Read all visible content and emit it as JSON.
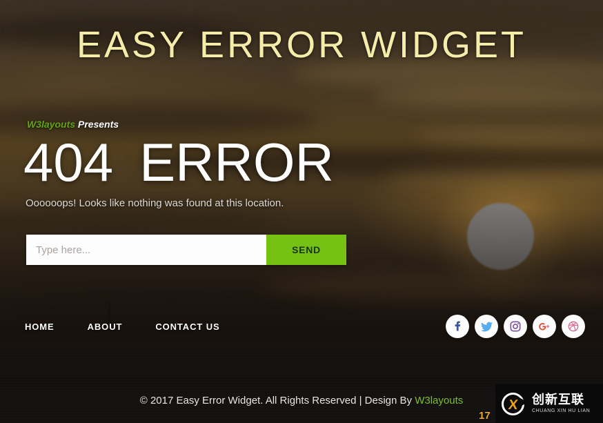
{
  "site": {
    "title": "EASY ERROR WIDGET",
    "title_color": "#f6ecaa"
  },
  "hero": {
    "presents_brand": "W3layouts",
    "presents_text": "Presents",
    "error_code": "404",
    "error_word": "ERROR",
    "subtitle": "Oooooops! Looks like nothing was found at this location."
  },
  "search": {
    "placeholder": "Type here...",
    "value": "",
    "button_label": "SEND",
    "button_color": "#76c214"
  },
  "nav": {
    "items": [
      {
        "label": "HOME",
        "name": "nav-link-home"
      },
      {
        "label": "ABOUT",
        "name": "nav-link-about"
      },
      {
        "label": "CONTACT  US",
        "name": "nav-link-contact-us"
      }
    ]
  },
  "socials": {
    "items": [
      {
        "icon": "facebook-icon",
        "glyph": "f",
        "color": "#3b5998"
      },
      {
        "icon": "twitter-icon",
        "glyph": "bird",
        "color": "#55acee"
      },
      {
        "icon": "instagram-icon",
        "glyph": "camera",
        "color": "#7d4fa0"
      },
      {
        "icon": "google-plus-icon",
        "glyph": "G+",
        "color": "#dd4b39"
      },
      {
        "icon": "dribbble-icon",
        "glyph": "ball",
        "color": "#d playfully"
      }
    ]
  },
  "footer": {
    "text_before": "© 2017 Easy Error Widget. All Rights Reserved | Design By ",
    "brand": "W3layouts",
    "brand_color": "#7cc121"
  },
  "watermark": {
    "x_glyph": "X",
    "cn_name": "创新互联",
    "pinyin": "CHUANG XIN HU LIAN",
    "badge": "17"
  }
}
